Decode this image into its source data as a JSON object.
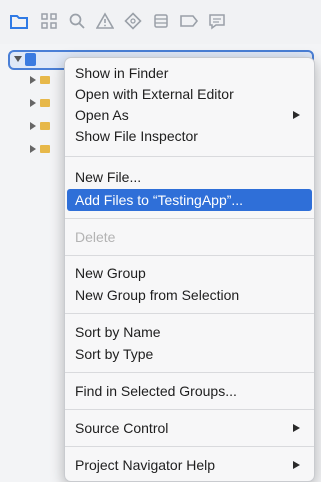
{
  "navigator": {
    "icons": [
      "folder-icon",
      "source-control-icon",
      "search-icon",
      "warning-icon",
      "test-icon",
      "debug-icon",
      "breakpoint-icon",
      "report-icon"
    ],
    "accent_color": "#3b7be0"
  },
  "context_menu": {
    "groups": [
      [
        {
          "label": "Show in Finder"
        },
        {
          "label": "Open with External Editor"
        },
        {
          "label": "Open As",
          "submenu": true
        },
        {
          "label": "Show File Inspector"
        }
      ],
      [
        {
          "label": "New File..."
        },
        {
          "label": "Add Files to “TestingApp”...",
          "selected": true
        }
      ],
      [
        {
          "label": "Delete",
          "disabled": true
        }
      ],
      [
        {
          "label": "New Group"
        },
        {
          "label": "New Group from Selection"
        }
      ],
      [
        {
          "label": "Sort by Name"
        },
        {
          "label": "Sort by Type"
        }
      ],
      [
        {
          "label": "Find in Selected Groups..."
        }
      ],
      [
        {
          "label": "Source Control",
          "submenu": true
        }
      ],
      [
        {
          "label": "Project Navigator Help",
          "submenu": true
        }
      ]
    ],
    "selection_color": "#2f6fd8"
  }
}
